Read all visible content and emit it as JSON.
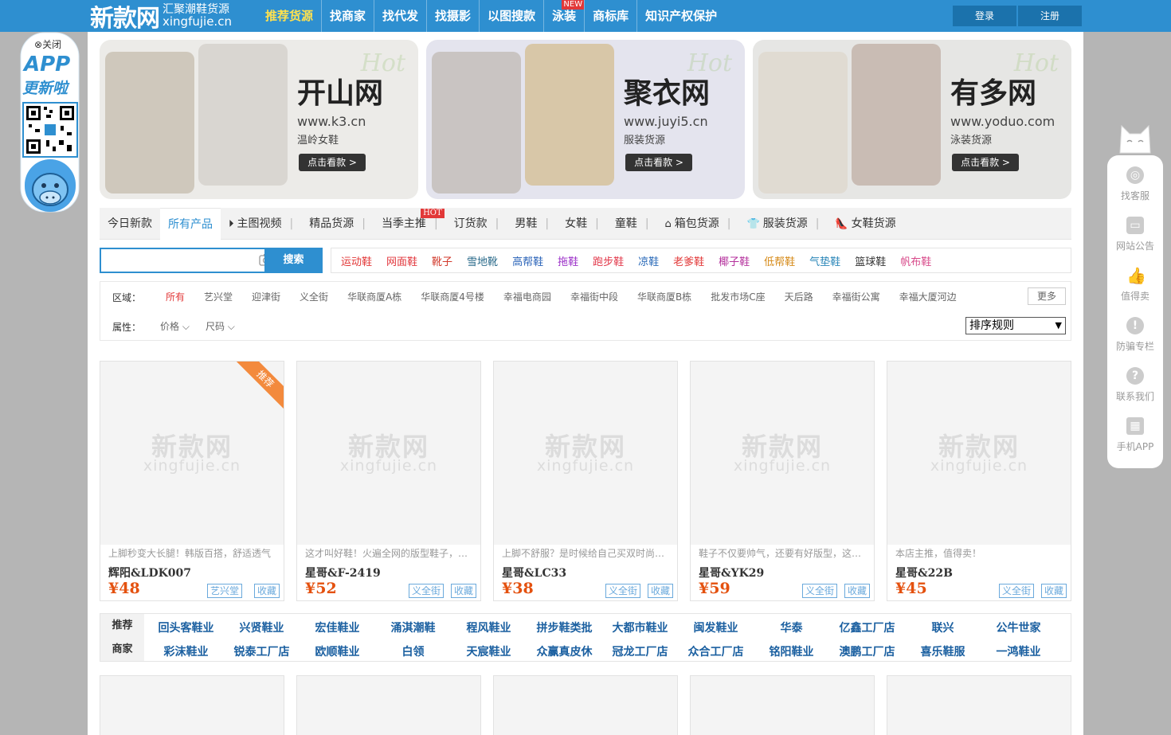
{
  "header": {
    "logo_main": "新款网",
    "logo_tagline": "汇聚潮鞋货源",
    "logo_domain": "xingfujie.cn",
    "nav": [
      {
        "label": "推荐货源",
        "badge": ""
      },
      {
        "label": "找商家",
        "badge": ""
      },
      {
        "label": "找代发",
        "badge": ""
      },
      {
        "label": "找摄影",
        "badge": ""
      },
      {
        "label": "以图搜款",
        "badge": ""
      },
      {
        "label": "泳装",
        "badge": "NEW"
      },
      {
        "label": "商标库",
        "badge": ""
      },
      {
        "label": "知识产权保护",
        "badge": ""
      }
    ],
    "login": "登录",
    "register": "注册"
  },
  "banners": [
    {
      "title": "开山网",
      "url": "www.k3.cn",
      "desc": "温岭女鞋",
      "button": "点击看款 >",
      "hot": "Hot"
    },
    {
      "title": "聚衣网",
      "url": "www.juyi5.cn",
      "desc": "服装货源",
      "button": "点击看款 >",
      "hot": "Hot"
    },
    {
      "title": "有多网",
      "url": "www.yoduo.com",
      "desc": "泳装货源",
      "button": "点击看款 >",
      "hot": "Hot"
    }
  ],
  "tabs": {
    "t0": "今日新款",
    "t1": "所有产品",
    "t2": "主图视频",
    "t3": "精品货源",
    "t4": "当季主推",
    "t4_badge": "HOT",
    "t5": "订货款",
    "t6": "男鞋",
    "t7": "女鞋",
    "t8": "童鞋",
    "t9": "箱包货源",
    "t10": "服装货源",
    "t11": "女鞋货源"
  },
  "search": {
    "placeholder": "",
    "button": "搜索"
  },
  "categories": [
    {
      "label": "运动鞋",
      "color": "#e23838"
    },
    {
      "label": "网面鞋",
      "color": "#e2383e"
    },
    {
      "label": "靴子",
      "color": "#d23a2c"
    },
    {
      "label": "雪地靴",
      "color": "#2a6a8a"
    },
    {
      "label": "高帮鞋",
      "color": "#2a63b8"
    },
    {
      "label": "拖鞋",
      "color": "#9b2fc8"
    },
    {
      "label": "跑步鞋",
      "color": "#e2384a"
    },
    {
      "label": "凉鞋",
      "color": "#2a6ab8"
    },
    {
      "label": "老爹鞋",
      "color": "#e23838"
    },
    {
      "label": "椰子鞋",
      "color": "#b4309c"
    },
    {
      "label": "低帮鞋",
      "color": "#d68a18"
    },
    {
      "label": "气垫鞋",
      "color": "#2a86b8"
    },
    {
      "label": "篮球鞋",
      "color": "#333333"
    },
    {
      "label": "帆布鞋",
      "color": "#d84a8a"
    }
  ],
  "filter": {
    "area_label": "区域：",
    "areas": [
      "所有",
      "艺兴堂",
      "迎津街",
      "义全街",
      "华联商厦A栋",
      "华联商厦4号楼",
      "幸福电商园",
      "幸福街中段",
      "华联商厦B栋",
      "批发市场C座",
      "天后路",
      "幸福街公寓",
      "幸福大厦河边"
    ],
    "more": "更多",
    "attr_label": "属性：",
    "price": "价格",
    "size": "尺码",
    "sort": "排序规则"
  },
  "products": [
    {
      "desc": "上脚秒变大长腿！韩版百搭，舒适透气",
      "code": "辉阳&LDK007",
      "price": "¥48",
      "market": "艺兴堂",
      "fav": "收藏",
      "ribbon": "推荐"
    },
    {
      "desc": "这才叫好鞋！火遍全网的版型鞋子，你值得拥有",
      "code": "星哥&F-2419",
      "price": "¥52",
      "market": "义全街",
      "fav": "收藏",
      "ribbon": ""
    },
    {
      "desc": "上脚不舒服？是时候给自己买双时尚百搭的鞋了",
      "code": "星哥&LC33",
      "price": "¥38",
      "market": "义全街",
      "fav": "收藏",
      "ribbon": ""
    },
    {
      "desc": "鞋子不仅要帅气，还要有好版型，这款鞋两者兼备",
      "code": "星哥&YK29",
      "price": "¥59",
      "market": "义全街",
      "fav": "收藏",
      "ribbon": ""
    },
    {
      "desc": "本店主推，值得卖！",
      "code": "星哥&22B",
      "price": "¥45",
      "market": "义全街",
      "fav": "收藏",
      "ribbon": ""
    }
  ],
  "watermark": {
    "big": "新款网",
    "small": "xingfujie.cn"
  },
  "merchants": {
    "label_top": "推荐",
    "label_bottom": "商家",
    "row1": [
      "回头客鞋业",
      "兴贤鞋业",
      "宏佳鞋业",
      "涌淇潮鞋",
      "程风鞋业",
      "拼步鞋类批",
      "大都市鞋业",
      "闽发鞋业",
      "华泰",
      "亿鑫工厂店",
      "联兴",
      "公牛世家"
    ],
    "row2": [
      "彩沫鞋业",
      "锐泰工厂店",
      "欧顺鞋业",
      "白领",
      "天宸鞋业",
      "众赢真皮休",
      "冠龙工厂店",
      "众合工厂店",
      "铭阳鞋业",
      "澳鹏工厂店",
      "喜乐鞋服",
      "一鸿鞋业"
    ]
  },
  "app_ad": {
    "close": "关闭",
    "title": "APP",
    "subtitle": "更新啦"
  },
  "sidebar": [
    {
      "label": "找客服",
      "icon": "headset-icon"
    },
    {
      "label": "网站公告",
      "icon": "announcement-icon"
    },
    {
      "label": "值得卖",
      "icon": "thumbs-up-icon"
    },
    {
      "label": "防骗专栏",
      "icon": "warning-icon"
    },
    {
      "label": "联系我们",
      "icon": "question-icon"
    },
    {
      "label": "手机APP",
      "icon": "qr-icon"
    }
  ]
}
